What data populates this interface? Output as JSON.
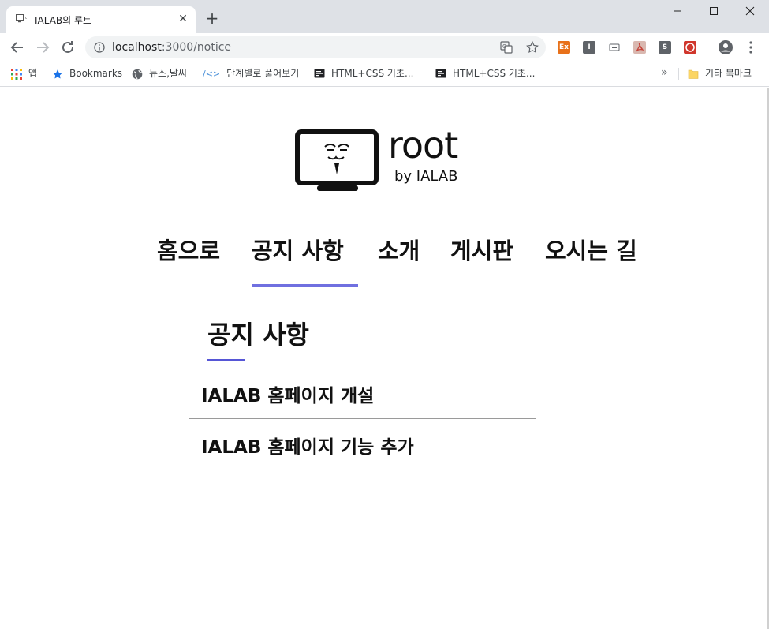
{
  "browser": {
    "tab": {
      "title": "IALAB의 루트",
      "close_icon": "close-icon"
    },
    "new_tab_label": "+",
    "address": {
      "host": "localhost",
      "path": ":3000/notice"
    },
    "bookmarks": [
      {
        "label": "앱",
        "icon": "apps-grid-icon"
      },
      {
        "label": "Bookmarks",
        "icon": "star-icon"
      },
      {
        "label": "뉴스,날씨",
        "icon": "globe-icon"
      },
      {
        "label": "단계별로 풀어보기",
        "icon": "code-icon"
      },
      {
        "label": "HTML+CSS 기초...",
        "icon": "doc-icon"
      },
      {
        "label": "HTML+CSS 기초...",
        "icon": "doc-icon"
      }
    ],
    "bookmarks_overflow": "»",
    "other_bookmarks": "기타 북마크",
    "extensions": [
      {
        "label": "Ex",
        "color": "#e8711a"
      },
      {
        "label": "I",
        "color": "#5f6368"
      },
      {
        "label": "",
        "color": "#9aa0a6"
      },
      {
        "label": "",
        "color": "#c5443a"
      },
      {
        "label": "S",
        "color": "#5f6368"
      },
      {
        "label": "",
        "color": "#d0362c"
      }
    ]
  },
  "site": {
    "logo": {
      "wordmark": "root",
      "byline": "by IALAB"
    },
    "nav": [
      {
        "label": "홈으로"
      },
      {
        "label": "공지 사항",
        "active": true
      },
      {
        "label": "소개"
      },
      {
        "label": "게시판"
      },
      {
        "label": "오시는 길"
      }
    ],
    "accent_color": "#7070e0",
    "section_title": "공지 사항",
    "notices": [
      {
        "title": "IALAB 홈페이지 개설"
      },
      {
        "title": "IALAB 홈페이지 기능 추가"
      }
    ]
  }
}
